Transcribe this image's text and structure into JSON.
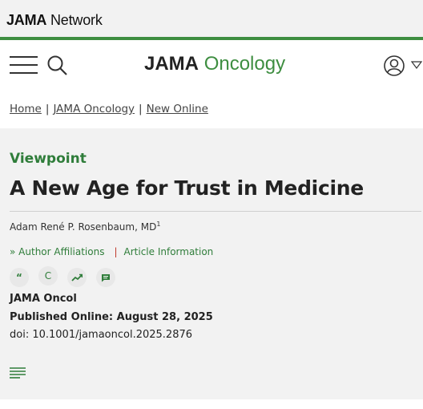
{
  "network": {
    "brand_bold": "JAMA",
    "brand_rest": " Network"
  },
  "header": {
    "brand_bold": "JAMA",
    "brand_rest": "Oncology"
  },
  "breadcrumb": [
    {
      "label": "Home"
    },
    {
      "label": "JAMA Oncology"
    },
    {
      "label": "New Online"
    }
  ],
  "breadcrumb_separator": "|",
  "article": {
    "type": "Viewpoint",
    "title": "A New Age for Trust in Medicine",
    "author": "Adam René P. Rosenbaum, MD",
    "author_sup": "1",
    "affiliations_label": "Author Affiliations",
    "affiliations_chevron": "»",
    "article_info_label": "Article Information",
    "divider": "|",
    "journal": "JAMA Oncol",
    "published": "Published Online: August 28, 2025",
    "doi": "doi: 10.1001/jamaoncol.2025.2876"
  },
  "tools": [
    {
      "icon": "quote-icon",
      "glyph": "“"
    },
    {
      "icon": "copyright-icon",
      "glyph": "C"
    },
    {
      "icon": "trending-icon",
      "glyph": ""
    },
    {
      "icon": "comment-icon",
      "glyph": ""
    }
  ],
  "colors": {
    "accent": "#3e8e41",
    "link": "#2f7d3a",
    "divider": "#c0392b",
    "panel": "#f2f2f2"
  }
}
